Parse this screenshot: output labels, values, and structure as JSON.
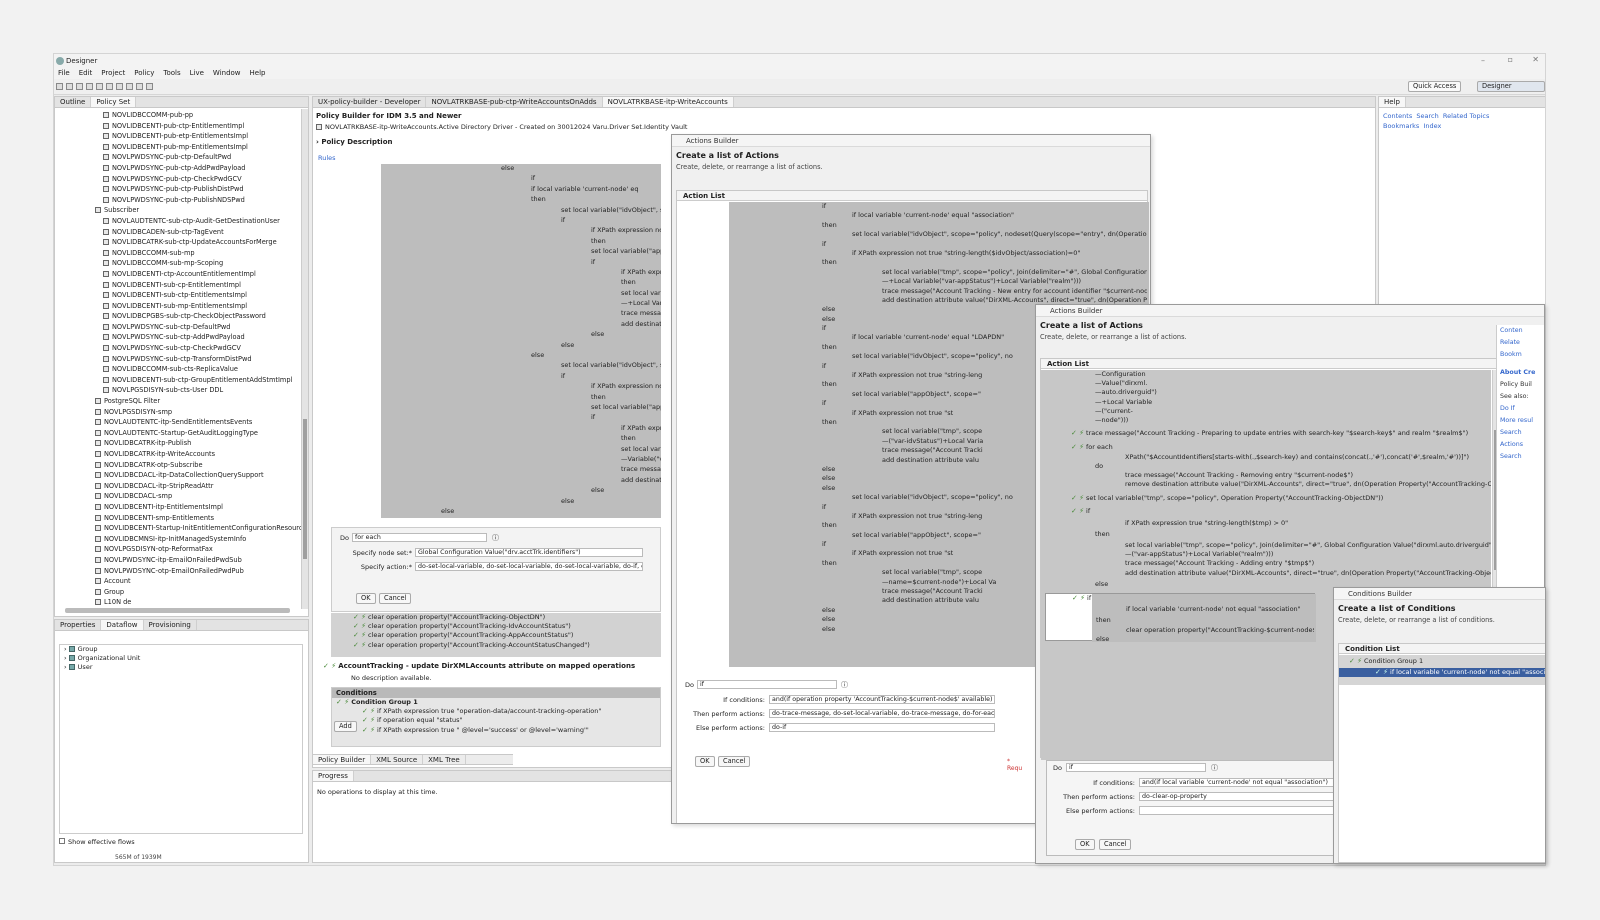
{
  "app": {
    "title": "Designer",
    "menu": [
      "File",
      "Edit",
      "Project",
      "Policy",
      "Tools",
      "Live",
      "Window",
      "Help"
    ],
    "quick_access": "Quick Access",
    "perspective": "Designer"
  },
  "left_panel": {
    "tabs": [
      "Outline",
      "Policy Set"
    ],
    "tree_items": [
      "NOVLIDBCCOMM-pub-pp",
      "NOVLIDBCENTI-pub-ctp-EntitlementImpl",
      "NOVLIDBCENTI-pub-etp-EntitlementsImpl",
      "NOVLIDBCENTI-pub-mp-EntitlementsImpl",
      "NOVLPWDSYNC-pub-ctp-DefaultPwd",
      "NOVLPWDSYNC-pub-ctp-AddPwdPayload",
      "NOVLPWDSYNC-pub-ctp-CheckPwdGCV",
      "NOVLPWDSYNC-pub-ctp-PublishDistPwd",
      "NOVLPWDSYNC-pub-ctp-PublishNDSPwd",
      "Subscriber",
      "NOVLAUDTENTC-sub-ctp-Audit-GetDestinationUser",
      "NOVLIDBCADEN-sub-ctp-TagEvent",
      "NOVLIDBCATRK-sub-ctp-UpdateAccountsForMerge",
      "NOVLIDBCCOMM-sub-mp",
      "NOVLIDBCCOMM-sub-mp-Scoping",
      "NOVLIDBCENTI-ctp-AccountEntitlementImpl",
      "NOVLIDBCENTI-sub-cp-EntitlementImpl",
      "NOVLIDBCENTI-sub-ctp-EntitlementsImpl",
      "NOVLIDBCENTI-sub-mp-EntitlementsImpl",
      "NOVLIDBCPGBS-sub-ctp-CheckObjectPassword",
      "NOVLPWDSYNC-sub-ctp-DefaultPwd",
      "NOVLPWDSYNC-sub-ctp-AddPwdPayload",
      "NOVLPWDSYNC-sub-ctp-CheckPwdGCV",
      "NOVLPWDSYNC-sub-ctp-TransformDistPwd",
      "NOVLIDBCCOMM-sub-cts-ReplicaValue",
      "NOVLIDBCENTI-sub-ctp-GroupEntitlementAddStmtImpl",
      "NOVLPGSDISYN-sub-cts-User DDL",
      "PostgreSQL Filter",
      "NOVLPGSDISYN-smp",
      "NOVLAUDTENTC-itp-SendEntitlementsEvents",
      "NOVLAUDTENTC-Startup-GetAuditLoggingType",
      "NOVLIDBCATRK-itp-Publish",
      "NOVLIDBCATRK-itp-WriteAccounts",
      "NOVLIDBCATRK-otp-Subscribe",
      "NOVLIDBCDACL-itp-DataCollectionQuerySupport",
      "NOVLIDBCDACL-itp-StripReadAttr",
      "NOVLIDBCDACL-smp",
      "NOVLIDBCENTI-itp-EntitlementsImpl",
      "NOVLIDBCENTI-smp-Entitlements",
      "NOVLIDBCENTI-Startup-InitEntitlementConfigurationResource",
      "NOVLIDBCMNSI-itp-InitManagedSystemInfo",
      "NOVLPGSDISYN-otp-ReformatFax",
      "NOVLPWDSYNC-itp-EmailOnFailedPwdSub",
      "NOVLPWDSYNC-otp-EmailOnFailedPwdPub",
      "Account",
      "Group",
      "L10N de"
    ]
  },
  "bottom_left": {
    "tabs": [
      "Properties",
      "Dataflow",
      "Provisioning"
    ],
    "items": [
      "Group",
      "Organizational Unit",
      "User"
    ],
    "show_flows": "Show effective flows",
    "memory": "565M of 1939M"
  },
  "editor": {
    "tabs": [
      "UX-policy-builder - Developer",
      "NOVLATRKBASE-pub-ctp-WriteAccountsOnAdds",
      "NOVLATRKBASE-itp-WriteAccounts"
    ],
    "heading": "Policy Builder for IDM 3.5 and Newer",
    "path": "NOVLATRKBASE-itp-WriteAccounts.Active Directory Driver - Created on 30012024 Varu.Driver Set.Identity Vault",
    "policy_description": "Policy Description",
    "rules": "Rules",
    "code_lines": [
      "else",
      "if",
      "if local variable 'current-node' eq",
      "then",
      "set local variable(\"idvObject\", sco",
      "if",
      "if XPath expression not t",
      "then",
      "set local variable(\"appO",
      "if",
      "if XPath expres",
      "then",
      "set local variat",
      "—+Local Varia",
      "trace message",
      "add destinati",
      "else",
      "else",
      "else",
      "set local variable(\"idvObject\", sco",
      "if",
      "if XPath expression not t",
      "then",
      "set local variable(\"appO",
      "if",
      "if XPath expres",
      "then",
      "set local variat",
      "—Variable(\"va",
      "trace message",
      "add destinati",
      "else",
      "else",
      "else"
    ],
    "do_label": "Do",
    "do_value": "for each",
    "node_set_label": "Specify node set:*",
    "node_set_value": "Global Configuration Value(\"drv.acctTrk.identifiers\")",
    "action_label": "Specify action:*",
    "action_value": "do-set-local-variable, do-set-local-variable, do-set-local-variable, do-if, c",
    "ok": "OK",
    "cancel": "Cancel",
    "clear_lines": [
      "clear operation property(\"AccountTracking-ObjectDN\")",
      "clear operation property(\"AccountTracking-IdvAccountStatus\")",
      "clear operation property(\"AccountTracking-AppAccountStatus\")",
      "clear operation property(\"AccountTracking-AccountStatusChanged\")"
    ],
    "rule_title": "AccountTracking - update DirXMLAccounts attribute on mapped operations",
    "no_desc": "No description available.",
    "conditions": "Conditions",
    "cond_group": "Condition Group 1",
    "cond_lines": [
      "if XPath expression true \"operation-data/account-tracking-operation\"",
      "if operation equal \"status\"",
      "if XPath expression true \" @level='success' or @level='warning'\""
    ],
    "add": "Add",
    "bottom_tabs": [
      "Policy Builder",
      "XML Source",
      "XML Tree"
    ]
  },
  "progress": {
    "tab": "Progress",
    "text": "No operations to display at this time."
  },
  "help": {
    "tab": "Help",
    "links": [
      "Contents",
      "Search",
      "Related Topics",
      "Bookmarks",
      "Index"
    ]
  },
  "dialog1": {
    "title": "Actions Builder",
    "heading": "Create a list of Actions",
    "sub": "Create, delete, or rearrange a list of actions.",
    "list_title": "Action List",
    "lines": [
      "if",
      "if local variable 'current-node' equal \"association\"",
      "then",
      "set local variable(\"idvObject\", scope=\"policy\", nodeset(Query(scope=\"entry\", dn(Operation Property(\"AccountTracking-ObjectDN\")), \"Object Class\")))",
      "if",
      "if XPath expression not true \"string-length($idvObject/association)=0\"",
      "then",
      "set local variable(\"tmp\", scope=\"policy\", Join(delimiter=\"#\", Global Configuration Value(\"dirxml.auto.driverguid\")+Local Variable(\"current-node\")+XPath(\"$idvObject/association\")+Local Variable(\"var-idvStatus\")",
      "—+Local Variable(\"var-appStatus\")+Local Variable(\"realm\")))",
      "trace message(\"Account Tracking - New entry for account identifier \"$current-node$\": $tmp$\")",
      "add destination attribute value(\"DirXML-Accounts\", direct=\"true\", dn(Operation Property(\"AccountTracking-ObjectDN\")), Local Variable(\"tmp\"))",
      "else",
      "else",
      "if",
      "if local variable 'current-node' equal \"LDAPDN\"",
      "then",
      "set local variable(\"idvObject\", scope=\"policy\", no",
      "if",
      "if XPath expression not true \"string-leng",
      "then",
      "set local variable(\"appObject\", scope=\"",
      "if",
      "if XPath expression not true \"st",
      "then",
      "set local variable(\"tmp\", scope",
      "—(\"var-idvStatus\")+Local Varia",
      "trace message(\"Account Tracki",
      "add destination attribute valu",
      "else",
      "else",
      "else",
      "set local variable(\"idvObject\", scope=\"policy\", no",
      "if",
      "if XPath expression not true \"string-leng",
      "then",
      "set local variable(\"appObject\", scope=\"",
      "if",
      "if XPath expression not true \"st",
      "then",
      "set local variable(\"tmp\", scope",
      "—name=$current-node\")+Local Va",
      "trace message(\"Account Tracki",
      "add destination attribute valu",
      "else",
      "else",
      "else"
    ],
    "do_label": "Do",
    "do_value": "if",
    "if_label": "If conditions:",
    "if_value": "and(if operation property 'AccountTracking-$current-node$' available)",
    "then_label": "Then perform actions:",
    "then_value": "do-trace-message, do-set-local-variable, do-trace-message, do-for-each",
    "else_label": "Else perform actions:",
    "else_value": "do-if",
    "ok": "OK",
    "cancel": "Cancel",
    "required": "* Requ"
  },
  "dialog2": {
    "title": "Actions Builder",
    "heading": "Create a list of Actions",
    "sub": "Create, delete, or rearrange a list of actions.",
    "list_title": "Action List",
    "lines": [
      "—Configuration",
      "—Value(\"dirxml.",
      "—auto.driverguid\")",
      "—+Local Variable",
      "—(\"current-",
      "—node\")))"
    ],
    "trace1": "trace message(\"Account Tracking - Preparing to update entries with search-key \"$search-key$\" and realm \"$realm$\")",
    "foreach": "for each",
    "xpath": "XPath(\"$AccountIdentifiers[starts-with(.,$search-key) and contains(concat(.,'#'),concat('#',$realm,'#'))]\")",
    "do": "do",
    "trace2": "trace message(\"Account Tracking - Removing entry \"$current-node$\")",
    "remove": "remove destination attribute value(\"DirXML-Accounts\", direct=\"true\", dn(Operation Property(\"AccountTracking-ObjectI",
    "setvar": "set local variable(\"tmp\", scope=\"policy\", Operation Property(\"AccountTracking-ObjectDN\"))",
    "if": "if",
    "if_xpath": "if XPath expression true \"string-length($tmp) > 0\"",
    "then": "then",
    "setjoin": "set local variable(\"tmp\", scope=\"policy\", Join(delimiter=\"#\", Global Configuration Value(\"dirxml.auto.driverguid\")+Loc",
    "setjoin2": "—(\"var-appStatus\")+Local Variable(\"realm\")))",
    "trace3": "trace message(\"Account Tracking - Adding entry \"$tmp$\")",
    "adddest": "add destination attribute value(\"DirXML-Accounts\", direct=\"true\", dn(Operation Property(\"AccountTracking-ObjectDN",
    "else": "else",
    "sel_if": "if",
    "sel_cond": "if local variable 'current-node' not equal \"association\"",
    "sel_then": "then",
    "sel_clear": "clear operation property(\"AccountTracking-$current-node$\")",
    "sel_else": "else",
    "do_label": "Do",
    "do_value": "if",
    "if_label": "If conditions:",
    "if_value": "and(if local variable 'current-node' not equal \"association\")",
    "then_label": "Then perform actions:",
    "then_value": "do-clear-op-property",
    "else_label": "Else perform actions:",
    "ok": "OK",
    "cancel": "Cancel"
  },
  "help2": {
    "links": [
      "Conten",
      "Relate",
      "Bookm"
    ],
    "about": "About Cre",
    "policy": "Policy Buil",
    "see_also": "See also:",
    "doif": "Do If",
    "more": "More resul",
    "search_actions": "Search Actions",
    "search": "Search"
  },
  "dialog3": {
    "title": "Conditions Builder",
    "heading": "Create a list of Conditions",
    "sub": "Create, delete, or rearrange a list of conditions.",
    "list_title": "Condition List",
    "group": "Condition Group 1",
    "selected": "if local variable 'current-node' not equal \"associ"
  }
}
